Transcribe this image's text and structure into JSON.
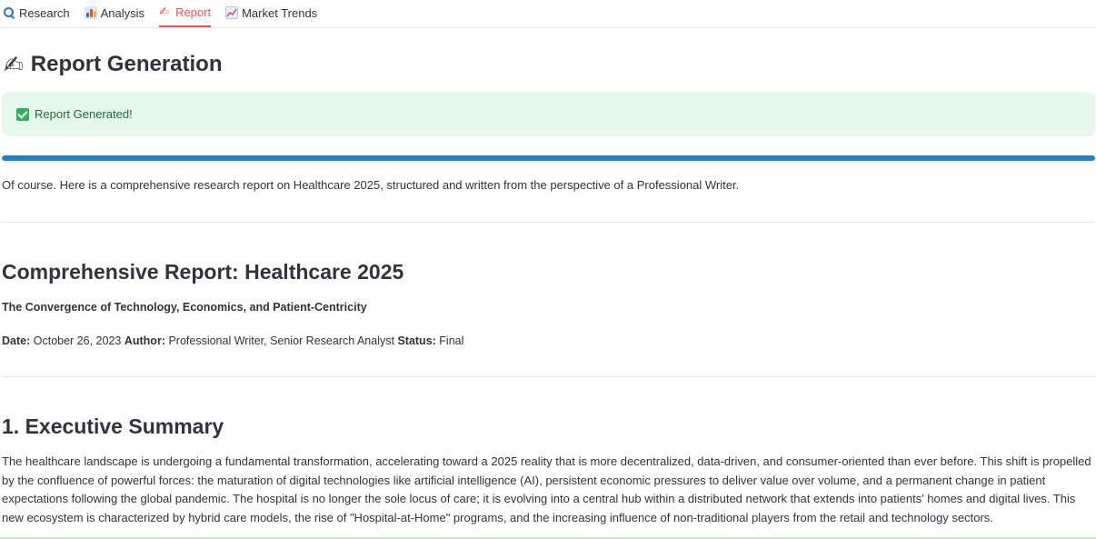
{
  "tabs": [
    {
      "label": "Research",
      "icon": "magnifier-icon",
      "active": false
    },
    {
      "label": "Analysis",
      "icon": "bar-chart-icon",
      "active": false
    },
    {
      "label": "Report",
      "icon": "writing-hand-icon",
      "active": true
    },
    {
      "label": "Market Trends",
      "icon": "trend-chart-icon",
      "active": false
    }
  ],
  "page": {
    "title": "Report Generation",
    "title_icon": "✍"
  },
  "alert": {
    "message": "Report Generated!",
    "color": "#177233",
    "background": "#e6f8ec"
  },
  "progress": {
    "value": 100,
    "color": "#1c7fd8"
  },
  "report": {
    "intro": "Of course. Here is a comprehensive research report on Healthcare 2025, structured and written from the perspective of a Professional Writer.",
    "heading": "Comprehensive Report: Healthcare 2025",
    "subtitle": "The Convergence of Technology, Economics, and Patient-Centricity",
    "meta": {
      "date_label": "Date:",
      "date": "October 26, 2023",
      "author_label": "Author:",
      "author": "Professional Writer, Senior Research Analyst",
      "status_label": "Status:",
      "status": "Final"
    },
    "section_heading": "1. Executive Summary",
    "section_body": "The healthcare landscape is undergoing a fundamental transformation, accelerating toward a 2025 reality that is more decentralized, data-driven, and consumer-oriented than ever before. This shift is propelled by the confluence of powerful forces: the maturation of digital technologies like artificial intelligence (AI), persistent economic pressures to deliver value over volume, and a permanent change in patient expectations following the global pandemic. The hospital is no longer the sole locus of care; it is evolving into a central hub within a distributed network that extends into patients' homes and digital lives. This new ecosystem is characterized by hybrid care models, the rise of \"Hospital-at-Home\" programs, and the increasing influence of non-traditional players from the retail and technology sectors."
  },
  "colors": {
    "accent": "#ff4b4b",
    "text": "#31333f"
  }
}
